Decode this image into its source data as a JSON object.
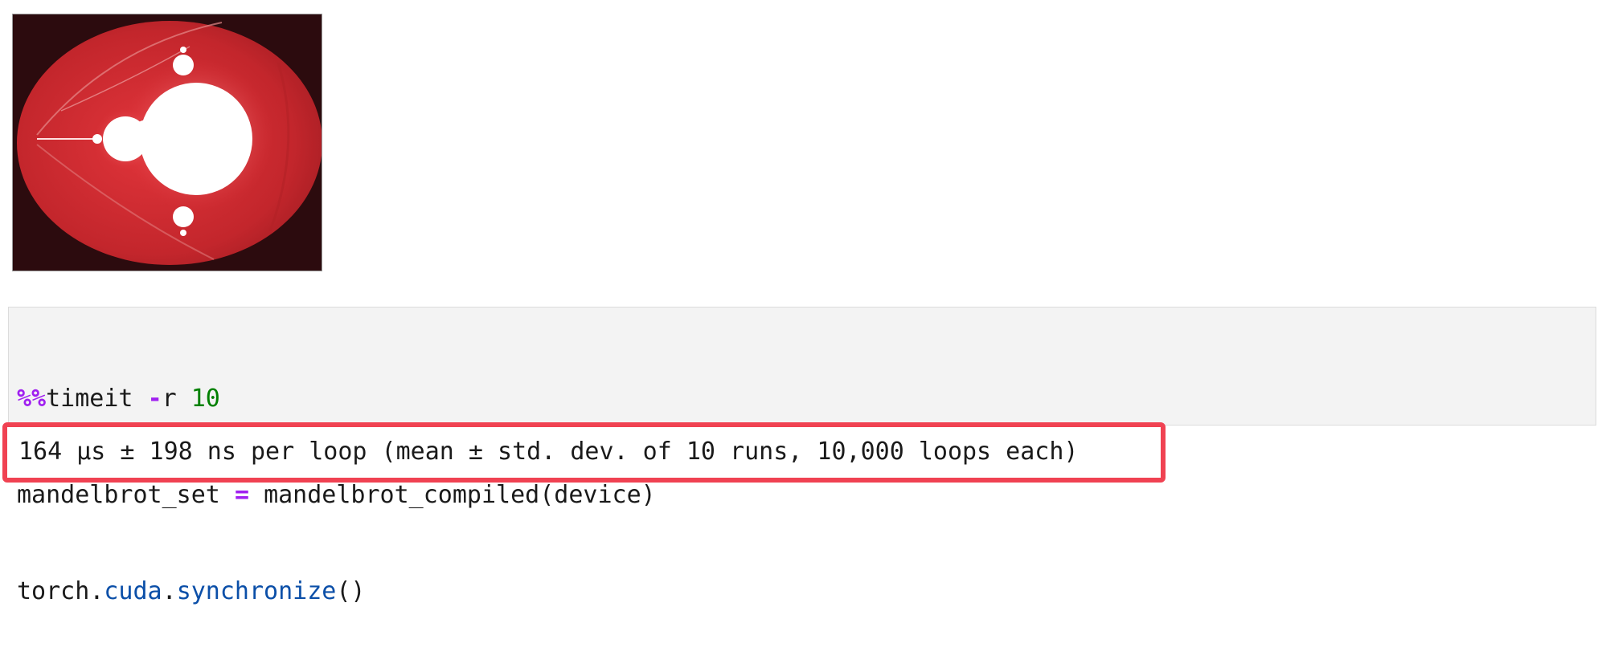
{
  "output_image": {
    "alt_name": "mandelbrot-plot"
  },
  "code_cell": {
    "line1": {
      "magic": "%%",
      "command": "timeit",
      "op": "-",
      "flag": "r",
      "number": "10"
    },
    "line2": {
      "lhs": "mandelbrot_set",
      "op": "=",
      "rhs": "mandelbrot_compiled(device)"
    },
    "line3": {
      "module": "torch",
      "dot1": ".",
      "attr": "cuda",
      "dot2": ".",
      "method": "synchronize",
      "parens": "()"
    }
  },
  "timing_output": {
    "text": "164 µs ± 198 ns per loop (mean ± std. dev. of 10 runs, 10,000 loops each)"
  },
  "colors": {
    "highlight_border": "#f04252",
    "magic_keyword": "#a020f0",
    "number": "#008000",
    "attribute": "#0b4fa8",
    "code_background": "#f3f3f3"
  }
}
